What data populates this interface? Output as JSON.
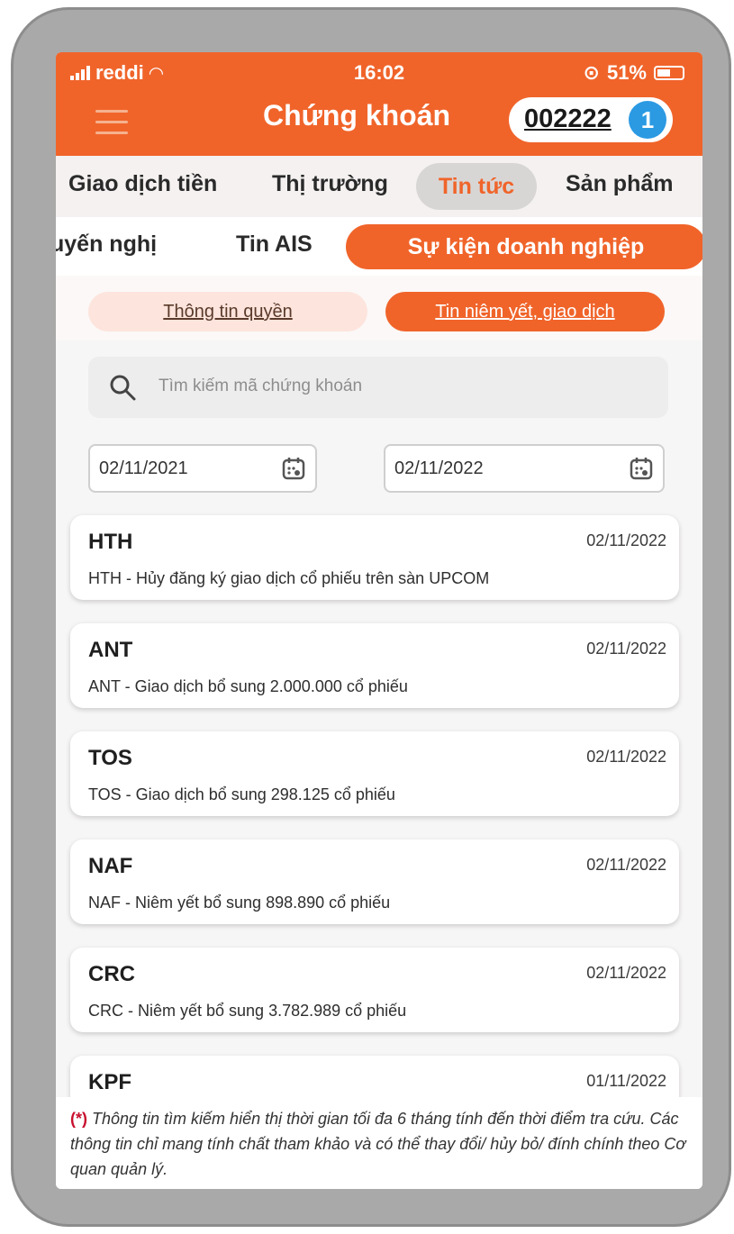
{
  "status_bar": {
    "carrier": "reddi",
    "time": "16:02",
    "battery": "51%"
  },
  "header": {
    "title": "Chứng khoán",
    "account_number": "002222",
    "badge": "1"
  },
  "main_tabs": [
    {
      "label": "Giao dịch tiền"
    },
    {
      "label": "Thị trường"
    },
    {
      "label": "Tin tức"
    },
    {
      "label": "Sản phẩm"
    }
  ],
  "sub_tabs": [
    {
      "label": "uyến nghị"
    },
    {
      "label": "Tin AIS"
    },
    {
      "label": "Sự kiện doanh nghiệp"
    }
  ],
  "segments": {
    "left": "Thông tin quyền",
    "right": "Tin niêm yết, giao dịch"
  },
  "search": {
    "placeholder": "Tìm kiếm mã chứng khoán"
  },
  "date_range": {
    "from": "02/11/2021",
    "to": "02/11/2022"
  },
  "news": [
    {
      "code": "HTH",
      "date": "02/11/2022",
      "desc": "HTH - Hủy đăng ký giao dịch cổ phiếu trên sàn UPCOM"
    },
    {
      "code": "ANT",
      "date": "02/11/2022",
      "desc": "ANT - Giao dịch bổ sung 2.000.000 cổ phiếu"
    },
    {
      "code": "TOS",
      "date": "02/11/2022",
      "desc": "TOS - Giao dịch bổ sung 298.125 cổ phiếu"
    },
    {
      "code": "NAF",
      "date": "02/11/2022",
      "desc": "NAF - Niêm yết bổ sung 898.890 cổ phiếu"
    },
    {
      "code": "CRC",
      "date": "02/11/2022",
      "desc": "CRC - Niêm yết bổ sung 3.782.989 cổ phiếu"
    },
    {
      "code": "KPF",
      "date": "01/11/2022",
      "desc": ""
    }
  ],
  "footnote": {
    "mark": "(*)",
    "text": " Thông tin tìm kiếm hiển thị thời gian tối đa 6 tháng tính đến thời điểm tra cứu. Các thông tin chỉ mang tính chất tham khảo và có thể thay đổi/ hủy bỏ/ đính chính theo Cơ quan quản lý."
  },
  "colors": {
    "accent": "#f0642a",
    "badge": "#2b9ae3"
  }
}
